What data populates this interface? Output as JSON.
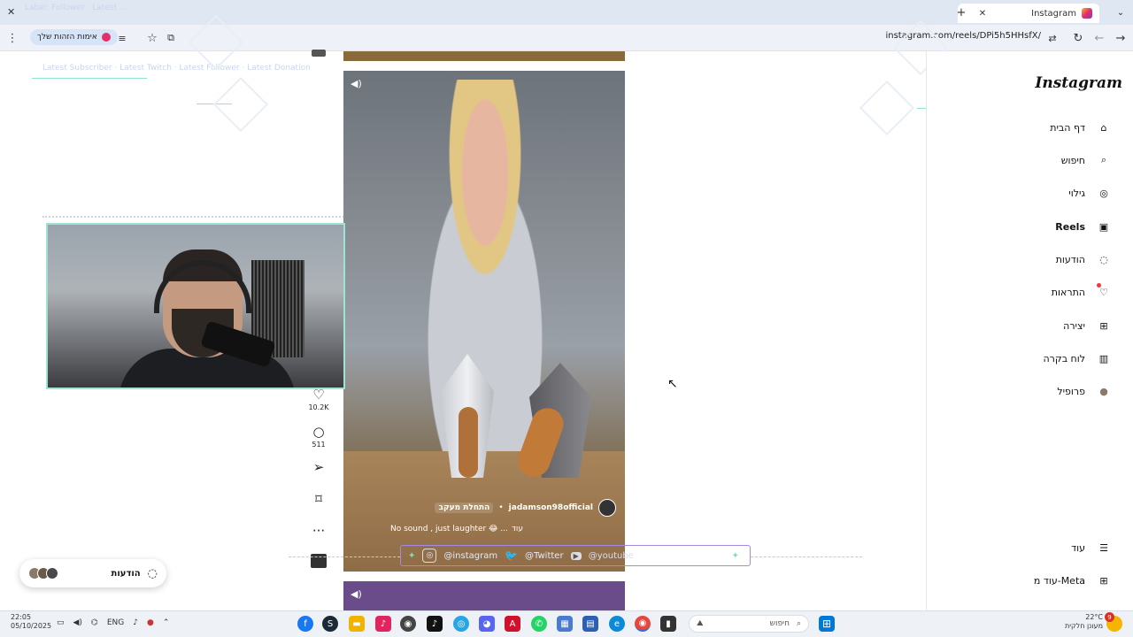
{
  "browser": {
    "tab_title": "Instagram",
    "url": "instagram.com/reels/DPi5h5HHsfX/",
    "chip_label": "אימות הזהות שלך",
    "faint_title": "Label: Follower · Latest ...",
    "faint_overlay": "Latest Subscriber · Latest Twitch · Latest Follower · Latest Donation"
  },
  "sidebar": {
    "logo": "Instagram",
    "items": [
      {
        "label": "דף הבית",
        "icon": "home-icon",
        "glyph": "⌂"
      },
      {
        "label": "חיפוש",
        "icon": "search-icon",
        "glyph": "⌕"
      },
      {
        "label": "גילוי",
        "icon": "compass-icon",
        "glyph": "◎"
      },
      {
        "label": "Reels",
        "icon": "reels-icon",
        "glyph": "▣"
      },
      {
        "label": "הודעות",
        "icon": "messenger-icon",
        "glyph": "◌"
      },
      {
        "label": "התראות",
        "icon": "heart-icon",
        "glyph": "♡"
      },
      {
        "label": "יצירה",
        "icon": "plus-icon",
        "glyph": "⊞"
      },
      {
        "label": "לוח בקרה",
        "icon": "dashboard-icon",
        "glyph": "▥"
      },
      {
        "label": "פרופיל",
        "icon": "avatar-icon",
        "glyph": "●"
      }
    ],
    "more_label": "עוד",
    "meta_label": "עוד מ-Meta"
  },
  "reel": {
    "username": "jadamson98official",
    "follow_label": "התחלת מעקב",
    "caption": "No sound , just laughter 😂 ...",
    "caption_more": "עוד",
    "likes": "10.2K",
    "comments": "511"
  },
  "messages": {
    "label": "הודעות"
  },
  "overlay": {
    "instagram_handle": "@instagram",
    "twitter_handle": "@Twitter",
    "youtube_handle": "@youtube"
  },
  "taskbar": {
    "time": "22:05",
    "date": "05/10/2025",
    "lang": "ENG",
    "search_placeholder": "חיפוש",
    "weather_temp": "22°C",
    "weather_desc": "מעונן חלקית",
    "notif_count": "9"
  }
}
